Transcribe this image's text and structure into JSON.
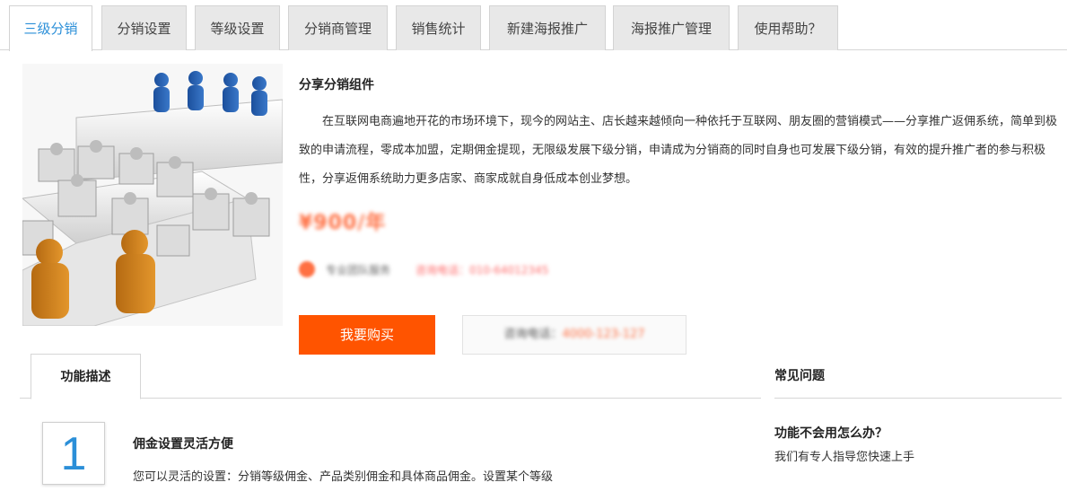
{
  "tabs": [
    {
      "label": "三级分销",
      "active": true
    },
    {
      "label": "分销设置",
      "active": false
    },
    {
      "label": "等级设置",
      "active": false
    },
    {
      "label": "分销商管理",
      "active": false
    },
    {
      "label": "销售统计",
      "active": false
    },
    {
      "label": "新建海报推广",
      "active": false
    },
    {
      "label": "海报推广管理",
      "active": false
    },
    {
      "label": "使用帮助？",
      "active": false
    }
  ],
  "product": {
    "title": "分享分销组件",
    "description": "在互联网电商遍地开花的市场环境下，现今的网站主、店长越来越倾向一种依托于互联网、朋友圈的营销模式——分享推广返佣系统，简单到极致的申请流程，零成本加盟，定期佣金提现，无限级发展下级分销，申请成为分销商的同时自身也可发展下级分销，有效的提升推广者的参与积极性，分享返佣系统助力更多店家、商家成就自身低成本创业梦想。",
    "price": "¥900/年",
    "info_gray": "专业团队服务",
    "info_red": "咨询电话：010-64012345",
    "buy_label": "我要购买",
    "hotline_label": "咨询电话：",
    "hotline_number": "4000-123-127"
  },
  "function_section": {
    "tab_label": "功能描述",
    "feature": {
      "number": "1",
      "title": "佣金设置灵活方便",
      "desc": "您可以灵活的设置：分销等级佣金、产品类别佣金和具体商品佣金。设置某个等级"
    }
  },
  "faq": {
    "title": "常见问题",
    "question": "功能不会用怎么办？",
    "answer": "我们有专人指导您快速上手"
  },
  "colors": {
    "accent_blue": "#2b8fd8",
    "buy_orange": "#ff5400",
    "price_orange": "#ff7043"
  },
  "icons": {
    "hero": "people-puzzle-illustration"
  }
}
